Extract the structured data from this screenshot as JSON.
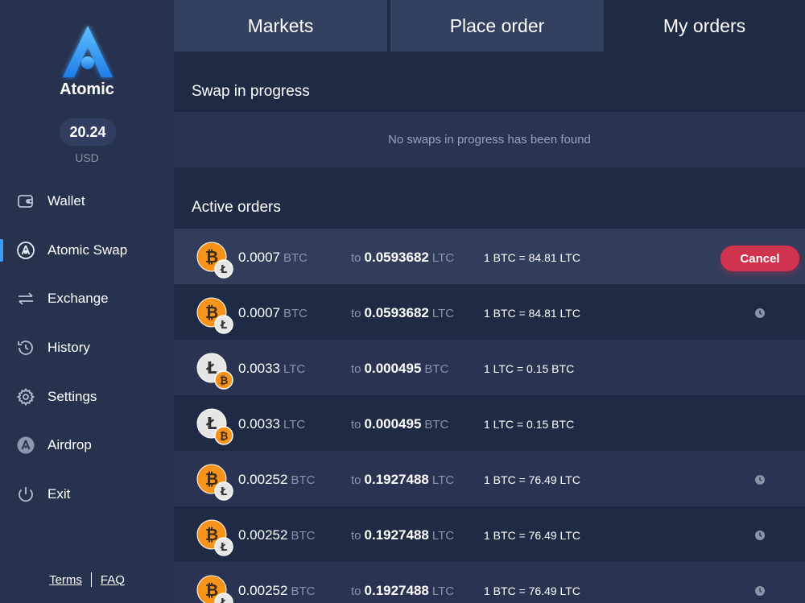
{
  "app": {
    "brand": "Atomic"
  },
  "balance": {
    "amount": "20.24",
    "currency": "USD"
  },
  "nav": [
    {
      "label": "Wallet",
      "icon": "wallet-icon"
    },
    {
      "label": "Atomic Swap",
      "icon": "atomic-swap-icon",
      "active": true
    },
    {
      "label": "Exchange",
      "icon": "exchange-icon"
    },
    {
      "label": "History",
      "icon": "history-icon"
    },
    {
      "label": "Settings",
      "icon": "gear-icon"
    },
    {
      "label": "Airdrop",
      "icon": "airdrop-icon"
    },
    {
      "label": "Exit",
      "icon": "power-icon"
    }
  ],
  "footer": {
    "terms": "Terms",
    "faq": "FAQ"
  },
  "tabs": [
    {
      "label": "Markets"
    },
    {
      "label": "Place order"
    },
    {
      "label": "My orders",
      "active": true
    }
  ],
  "swap": {
    "title": "Swap in progress",
    "empty": "No swaps in progress has been found"
  },
  "orders": {
    "title": "Active orders",
    "cancel_label": "Cancel",
    "to_label": "to",
    "rows": [
      {
        "amount": "0.0007",
        "from": "BTC",
        "to_amount": "0.0593682",
        "to": "LTC",
        "rate": "1 BTC = 84.81 LTC",
        "action": "cancel"
      },
      {
        "amount": "0.0007",
        "from": "BTC",
        "to_amount": "0.0593682",
        "to": "LTC",
        "rate": "1 BTC = 84.81 LTC",
        "action": "clock"
      },
      {
        "amount": "0.0033",
        "from": "LTC",
        "to_amount": "0.000495",
        "to": "BTC",
        "rate": "1 LTC = 0.15 BTC",
        "action": "none"
      },
      {
        "amount": "0.0033",
        "from": "LTC",
        "to_amount": "0.000495",
        "to": "BTC",
        "rate": "1 LTC = 0.15 BTC",
        "action": "none"
      },
      {
        "amount": "0.00252",
        "from": "BTC",
        "to_amount": "0.1927488",
        "to": "LTC",
        "rate": "1 BTC = 76.49 LTC",
        "action": "clock"
      },
      {
        "amount": "0.00252",
        "from": "BTC",
        "to_amount": "0.1927488",
        "to": "LTC",
        "rate": "1 BTC = 76.49 LTC",
        "action": "clock"
      },
      {
        "amount": "0.00252",
        "from": "BTC",
        "to_amount": "0.1927488",
        "to": "LTC",
        "rate": "1 BTC = 76.49 LTC",
        "action": "clock"
      }
    ]
  },
  "colors": {
    "accent": "#3d9cf5",
    "cancel": "#d1324e",
    "btc": "#f7931a",
    "ltc": "#e8e8e8"
  }
}
